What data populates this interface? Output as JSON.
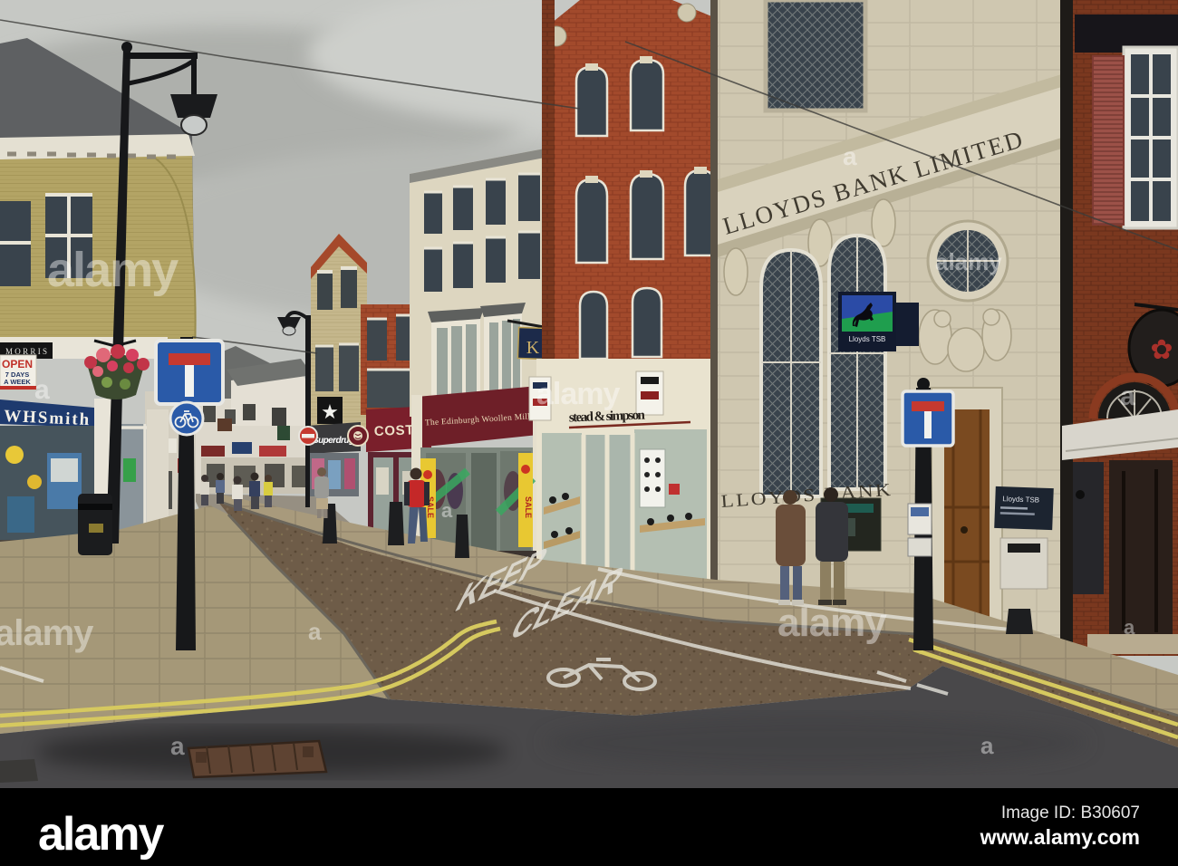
{
  "footer": {
    "brand": "alamy",
    "image_id": "Image ID: B30607",
    "url": "www.alamy.com"
  },
  "watermark": {
    "brand": "alamy",
    "letter": "a"
  },
  "signs": {
    "lloyds_frieze": "LLOYDS BANK LIMITED",
    "lloyds_ground": "LLOYDS BANK",
    "lloyds_tsb_hanging": "Lloyds TSB",
    "lloyds_tsb_plaque": "Lloyds TSB",
    "whsmith": "WHSmith",
    "morris": "MORRIS",
    "open_top": "OPEN",
    "open_mid": "7 DAYS",
    "open_bottom": "A WEEK",
    "superdrug": "Superdrug",
    "costa": "COSTA",
    "edinburgh_woollen_mill": "The Edinburgh Woollen Mill",
    "stead_simpson": "stead & simpson",
    "k_monogram": "K",
    "star": "★",
    "sale": "SALE",
    "emblem": "✿"
  },
  "road": {
    "keep": "KEEP",
    "clear": "CLEAR"
  },
  "colors": {
    "lloyds_sign_blue": "#2b4ba6",
    "lloyds_sign_green": "#1f9e4e",
    "costa_maroon": "#7a1f2b",
    "whsmith_navy": "#1e3a6e",
    "double_yellow": "#d6c95f",
    "stone": "#cfc7b0",
    "red_brick": "#a24a2c"
  }
}
